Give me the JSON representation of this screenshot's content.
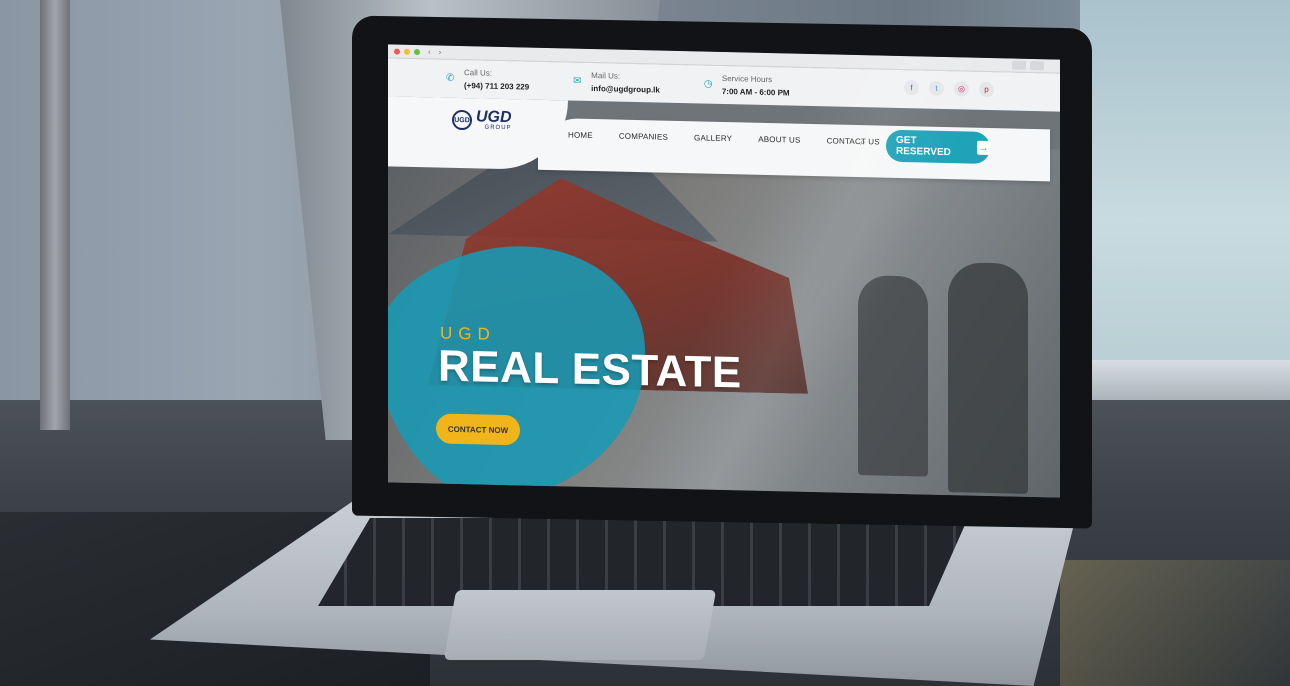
{
  "browser": {
    "back_arrow": "‹",
    "forward_arrow": "›"
  },
  "topbar": {
    "call_label": "Call Us:",
    "call_value": "(+94) 711 203 229",
    "mail_label": "Mail Us:",
    "mail_value": "info@ugdgroup.lk",
    "hours_label": "Service Hours",
    "hours_value": "7:00 AM - 6:00 PM",
    "icons": [
      "phone-icon",
      "mail-icon",
      "clock-icon"
    ],
    "socials": [
      {
        "name": "facebook-icon",
        "glyph": "f"
      },
      {
        "name": "twitter-icon",
        "glyph": "t"
      },
      {
        "name": "instagram-icon",
        "glyph": "◎"
      },
      {
        "name": "pinterest-icon",
        "glyph": "p"
      }
    ]
  },
  "logo": {
    "seal": "UGD",
    "word": "UGD",
    "sub": "GROUP"
  },
  "nav": {
    "items": [
      "HOME",
      "COMPANIES",
      "GALLERY",
      "ABOUT US",
      "CONTACT US"
    ],
    "search_icon": "⌕",
    "cta_label": "GET RESERVED",
    "cta_arrow": "→"
  },
  "hero": {
    "kicker": "UGD",
    "title": "REAL ESTATE",
    "button_label": "CONTACT NOW"
  },
  "colors": {
    "accent": "#1ea3b9",
    "cta_yellow": "#f0b51a",
    "brand_navy": "#1d2f63",
    "kicker_gold": "#e9b820"
  }
}
